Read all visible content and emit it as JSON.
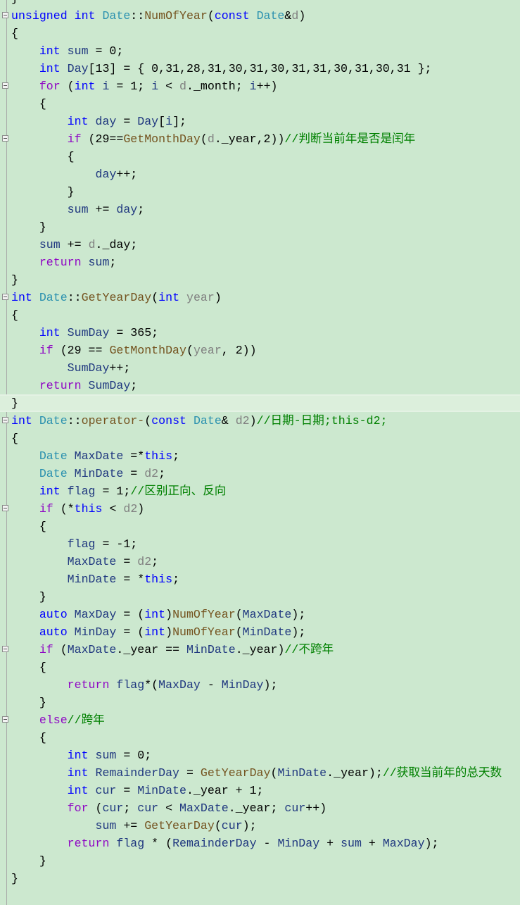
{
  "editor": {
    "colors": {
      "background": "#cce8cf",
      "keyword": "#0000ff",
      "control": "#8f08c4",
      "type": "#2b91af",
      "function": "#74531f",
      "variable": "#1f377f",
      "parameter": "#808080",
      "comment": "#008000"
    },
    "current_line": 23,
    "lines": [
      {
        "tokens": [
          [
            "n",
            "}"
          ]
        ]
      },
      {
        "fold": true,
        "tokens": [
          [
            "k",
            "unsigned int "
          ],
          [
            "t",
            "Date"
          ],
          [
            "n",
            "::"
          ],
          [
            "f",
            "NumOfYear"
          ],
          [
            "n",
            "("
          ],
          [
            "k",
            "const "
          ],
          [
            "t",
            "Date"
          ],
          [
            "n",
            "&"
          ],
          [
            "p",
            "d"
          ],
          [
            "n",
            ")"
          ]
        ]
      },
      {
        "tokens": [
          [
            "n",
            "{"
          ]
        ]
      },
      {
        "tokens": [
          [
            "k",
            "    int "
          ],
          [
            "v",
            "sum"
          ],
          [
            "n",
            " = 0;"
          ]
        ]
      },
      {
        "tokens": [
          [
            "k",
            "    int "
          ],
          [
            "v",
            "Day"
          ],
          [
            "n",
            "[13] = { 0,31,28,31,30,31,30,31,31,30,31,30,31 };"
          ]
        ]
      },
      {
        "fold": true,
        "tokens": [
          [
            "c",
            "    for "
          ],
          [
            "n",
            "("
          ],
          [
            "k",
            "int "
          ],
          [
            "v",
            "i"
          ],
          [
            "n",
            " = 1; "
          ],
          [
            "v",
            "i"
          ],
          [
            "n",
            " < "
          ],
          [
            "p",
            "d"
          ],
          [
            "n",
            "._month; "
          ],
          [
            "v",
            "i"
          ],
          [
            "n",
            "++)"
          ]
        ]
      },
      {
        "tokens": [
          [
            "n",
            "    {"
          ]
        ]
      },
      {
        "tokens": [
          [
            "k",
            "        int "
          ],
          [
            "v",
            "day"
          ],
          [
            "n",
            " = "
          ],
          [
            "v",
            "Day"
          ],
          [
            "n",
            "["
          ],
          [
            "v",
            "i"
          ],
          [
            "n",
            "];"
          ]
        ]
      },
      {
        "fold": true,
        "tokens": [
          [
            "c",
            "        if "
          ],
          [
            "n",
            "(29=="
          ],
          [
            "f",
            "GetMonthDay"
          ],
          [
            "n",
            "("
          ],
          [
            "p",
            "d"
          ],
          [
            "n",
            "._year,2))"
          ],
          [
            "g",
            "//判断当前年是否是闰年"
          ]
        ]
      },
      {
        "tokens": [
          [
            "n",
            "        {"
          ]
        ]
      },
      {
        "tokens": [
          [
            "v",
            "            day"
          ],
          [
            "n",
            "++;"
          ]
        ]
      },
      {
        "tokens": [
          [
            "n",
            "        }"
          ]
        ]
      },
      {
        "tokens": [
          [
            "v",
            "        sum"
          ],
          [
            "n",
            " += "
          ],
          [
            "v",
            "day"
          ],
          [
            "n",
            ";"
          ]
        ]
      },
      {
        "tokens": [
          [
            "n",
            "    }"
          ]
        ]
      },
      {
        "tokens": [
          [
            "v",
            "    sum"
          ],
          [
            "n",
            " += "
          ],
          [
            "p",
            "d"
          ],
          [
            "n",
            "._day;"
          ]
        ]
      },
      {
        "tokens": [
          [
            "c",
            "    return "
          ],
          [
            "v",
            "sum"
          ],
          [
            "n",
            ";"
          ]
        ]
      },
      {
        "tokens": [
          [
            "n",
            "}"
          ]
        ]
      },
      {
        "fold": true,
        "tokens": [
          [
            "k",
            "int "
          ],
          [
            "t",
            "Date"
          ],
          [
            "n",
            "::"
          ],
          [
            "f",
            "GetYearDay"
          ],
          [
            "n",
            "("
          ],
          [
            "k",
            "int "
          ],
          [
            "p",
            "year"
          ],
          [
            "n",
            ")"
          ]
        ]
      },
      {
        "tokens": [
          [
            "n",
            "{"
          ]
        ]
      },
      {
        "tokens": [
          [
            "k",
            "    int "
          ],
          [
            "v",
            "SumDay"
          ],
          [
            "n",
            " = 365;"
          ]
        ]
      },
      {
        "tokens": [
          [
            "c",
            "    if "
          ],
          [
            "n",
            "(29 == "
          ],
          [
            "f",
            "GetMonthDay"
          ],
          [
            "n",
            "("
          ],
          [
            "p",
            "year"
          ],
          [
            "n",
            ", 2))"
          ]
        ]
      },
      {
        "tokens": [
          [
            "v",
            "        SumDay"
          ],
          [
            "n",
            "++;"
          ]
        ]
      },
      {
        "tokens": [
          [
            "c",
            "    return "
          ],
          [
            "v",
            "SumDay"
          ],
          [
            "n",
            ";"
          ]
        ]
      },
      {
        "tokens": [
          [
            "n",
            "}"
          ]
        ]
      },
      {
        "fold": true,
        "tokens": [
          [
            "k",
            "int "
          ],
          [
            "t",
            "Date"
          ],
          [
            "n",
            "::"
          ],
          [
            "f",
            "operator-"
          ],
          [
            "n",
            "("
          ],
          [
            "k",
            "const "
          ],
          [
            "t",
            "Date"
          ],
          [
            "n",
            "& "
          ],
          [
            "p",
            "d2"
          ],
          [
            "n",
            ")"
          ],
          [
            "g",
            "//日期-日期;this-d2;"
          ]
        ]
      },
      {
        "tokens": [
          [
            "n",
            "{"
          ]
        ]
      },
      {
        "tokens": [
          [
            "t",
            "    Date "
          ],
          [
            "v",
            "MaxDate"
          ],
          [
            "n",
            " =*"
          ],
          [
            "k",
            "this"
          ],
          [
            "n",
            ";"
          ]
        ]
      },
      {
        "tokens": [
          [
            "t",
            "    Date "
          ],
          [
            "v",
            "MinDate"
          ],
          [
            "n",
            " = "
          ],
          [
            "p",
            "d2"
          ],
          [
            "n",
            ";"
          ]
        ]
      },
      {
        "tokens": [
          [
            "k",
            "    int "
          ],
          [
            "v",
            "flag"
          ],
          [
            "n",
            " = 1;"
          ],
          [
            "g",
            "//区别正向、反向"
          ]
        ]
      },
      {
        "fold": true,
        "tokens": [
          [
            "c",
            "    if "
          ],
          [
            "n",
            "(*"
          ],
          [
            "k",
            "this"
          ],
          [
            "n",
            " < "
          ],
          [
            "p",
            "d2"
          ],
          [
            "n",
            ")"
          ]
        ]
      },
      {
        "tokens": [
          [
            "n",
            "    {"
          ]
        ]
      },
      {
        "tokens": [
          [
            "v",
            "        flag"
          ],
          [
            "n",
            " = -1;"
          ]
        ]
      },
      {
        "tokens": [
          [
            "v",
            "        MaxDate"
          ],
          [
            "n",
            " = "
          ],
          [
            "p",
            "d2"
          ],
          [
            "n",
            ";"
          ]
        ]
      },
      {
        "tokens": [
          [
            "v",
            "        MinDate"
          ],
          [
            "n",
            " = *"
          ],
          [
            "k",
            "this"
          ],
          [
            "n",
            ";"
          ]
        ]
      },
      {
        "tokens": [
          [
            "n",
            "    }"
          ]
        ]
      },
      {
        "tokens": [
          [
            "k",
            "    auto "
          ],
          [
            "v",
            "MaxDay"
          ],
          [
            "n",
            " = ("
          ],
          [
            "k",
            "int"
          ],
          [
            "n",
            ")"
          ],
          [
            "f",
            "NumOfYear"
          ],
          [
            "n",
            "("
          ],
          [
            "v",
            "MaxDate"
          ],
          [
            "n",
            ");"
          ]
        ]
      },
      {
        "tokens": [
          [
            "k",
            "    auto "
          ],
          [
            "v",
            "MinDay"
          ],
          [
            "n",
            " = ("
          ],
          [
            "k",
            "int"
          ],
          [
            "n",
            ")"
          ],
          [
            "f",
            "NumOfYear"
          ],
          [
            "n",
            "("
          ],
          [
            "v",
            "MinDate"
          ],
          [
            "n",
            ");"
          ]
        ]
      },
      {
        "fold": true,
        "tokens": [
          [
            "c",
            "    if "
          ],
          [
            "n",
            "("
          ],
          [
            "v",
            "MaxDate"
          ],
          [
            "n",
            "._year == "
          ],
          [
            "v",
            "MinDate"
          ],
          [
            "n",
            "._year)"
          ],
          [
            "g",
            "//不跨年"
          ]
        ]
      },
      {
        "tokens": [
          [
            "n",
            "    {"
          ]
        ]
      },
      {
        "tokens": [
          [
            "c",
            "        return "
          ],
          [
            "v",
            "flag"
          ],
          [
            "n",
            "*("
          ],
          [
            "v",
            "MaxDay"
          ],
          [
            "n",
            " - "
          ],
          [
            "v",
            "MinDay"
          ],
          [
            "n",
            ");"
          ]
        ]
      },
      {
        "tokens": [
          [
            "n",
            "    }"
          ]
        ]
      },
      {
        "fold": true,
        "tokens": [
          [
            "c",
            "    else"
          ],
          [
            "g",
            "//跨年"
          ]
        ]
      },
      {
        "tokens": [
          [
            "n",
            "    {"
          ]
        ]
      },
      {
        "tokens": [
          [
            "k",
            "        int "
          ],
          [
            "v",
            "sum"
          ],
          [
            "n",
            " = 0;"
          ]
        ]
      },
      {
        "tokens": [
          [
            "k",
            "        int "
          ],
          [
            "v",
            "RemainderDay"
          ],
          [
            "n",
            " = "
          ],
          [
            "f",
            "GetYearDay"
          ],
          [
            "n",
            "("
          ],
          [
            "v",
            "MinDate"
          ],
          [
            "n",
            "._year);"
          ],
          [
            "g",
            "//获取当前年的总天数"
          ]
        ]
      },
      {
        "tokens": [
          [
            "k",
            "        int "
          ],
          [
            "v",
            "cur"
          ],
          [
            "n",
            " = "
          ],
          [
            "v",
            "MinDate"
          ],
          [
            "n",
            "._year + 1;"
          ]
        ]
      },
      {
        "tokens": [
          [
            "c",
            "        for "
          ],
          [
            "n",
            "("
          ],
          [
            "v",
            "cur"
          ],
          [
            "n",
            "; "
          ],
          [
            "v",
            "cur"
          ],
          [
            "n",
            " < "
          ],
          [
            "v",
            "MaxDate"
          ],
          [
            "n",
            "._year; "
          ],
          [
            "v",
            "cur"
          ],
          [
            "n",
            "++)"
          ]
        ]
      },
      {
        "tokens": [
          [
            "v",
            "            sum"
          ],
          [
            "n",
            " += "
          ],
          [
            "f",
            "GetYearDay"
          ],
          [
            "n",
            "("
          ],
          [
            "v",
            "cur"
          ],
          [
            "n",
            ");"
          ]
        ]
      },
      {
        "tokens": [
          [
            "c",
            "        return "
          ],
          [
            "v",
            "flag"
          ],
          [
            "n",
            " * ("
          ],
          [
            "v",
            "RemainderDay"
          ],
          [
            "n",
            " - "
          ],
          [
            "v",
            "MinDay"
          ],
          [
            "n",
            " + "
          ],
          [
            "v",
            "sum"
          ],
          [
            "n",
            " + "
          ],
          [
            "v",
            "MaxDay"
          ],
          [
            "n",
            ");"
          ]
        ]
      },
      {
        "tokens": [
          [
            "n",
            "    }"
          ]
        ]
      },
      {
        "tokens": [
          [
            "n",
            "}"
          ]
        ]
      }
    ]
  }
}
